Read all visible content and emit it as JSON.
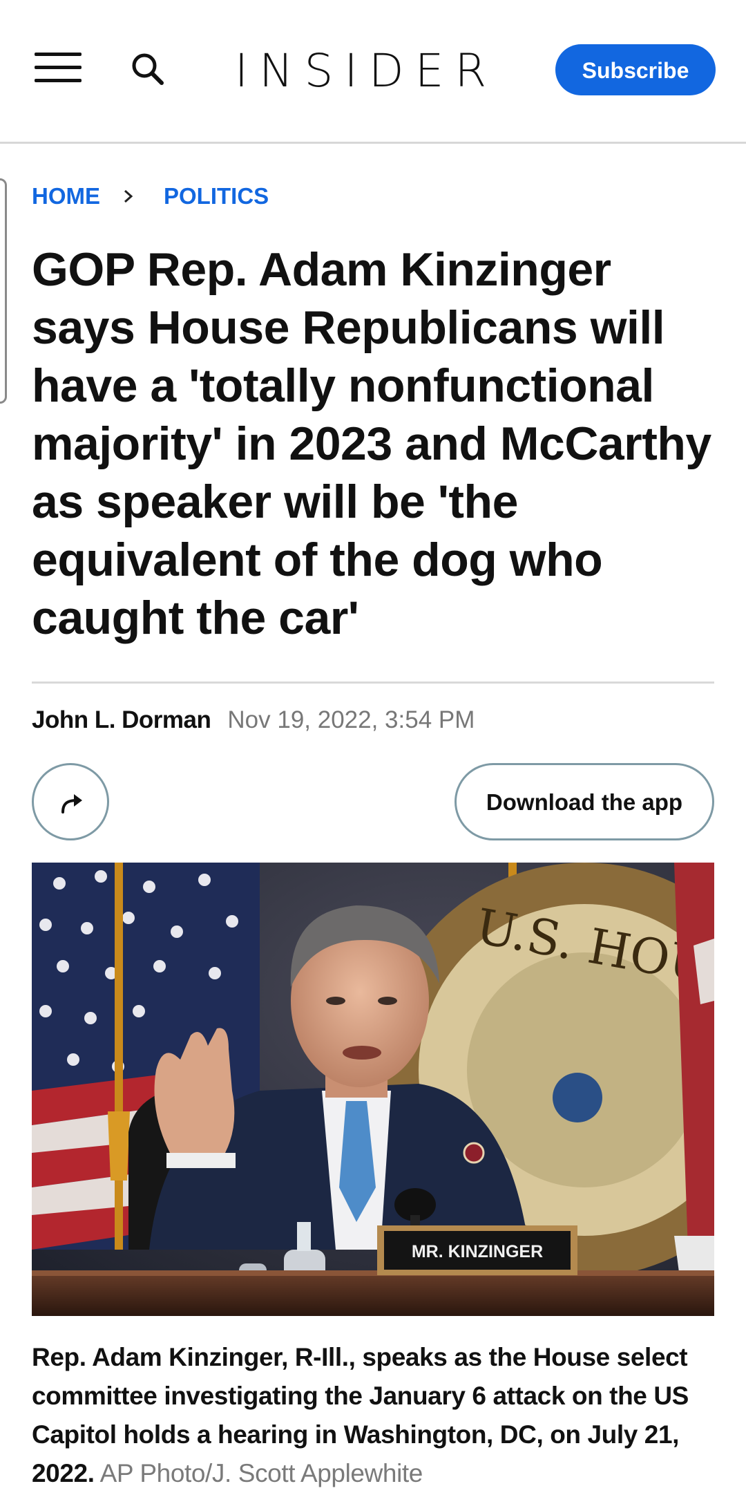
{
  "header": {
    "logo": "INSIDER",
    "subscribe_label": "Subscribe",
    "brand_color": "#1267e0"
  },
  "breadcrumb": {
    "items": [
      "HOME",
      "POLITICS"
    ]
  },
  "article": {
    "headline": "GOP Rep. Adam Kinzinger says House Republicans will have a 'totally nonfunctional majority' in 2023 and McCarthy as speaker will be 'the equivalent of the dog who caught the car'",
    "author": "John L. Dorman",
    "date": "Nov 19, 2022, 3:54 PM"
  },
  "actions": {
    "share_icon": "share-arrow-icon",
    "download_label": "Download the app"
  },
  "photo": {
    "nameplate": "MR. KINZINGER",
    "seal_text": "U.S. HOUSE OF",
    "caption": "Rep. Adam Kinzinger, R-Ill., speaks as the House select committee investigating the January 6 attack on the US Capitol holds a hearing in Washington, DC, on July 21, 2022.",
    "credit": "AP Photo/J. Scott Applewhite"
  }
}
